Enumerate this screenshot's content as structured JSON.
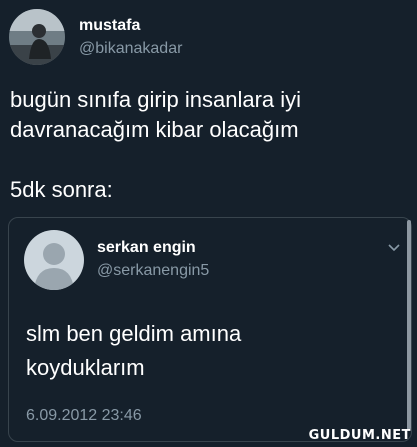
{
  "tweet": {
    "display_name": "mustafa",
    "handle": "@bikanakadar",
    "text": "bugün sınıfa girip insanlara iyi\ndavranacağım kibar olacağım\n\n5dk sonra:",
    "avatar_icon": "user-photo"
  },
  "quoted_tweet": {
    "display_name": "serkan engin",
    "handle": "@serkanengin5",
    "text": "slm ben geldim amına\nkoyduklarım",
    "timestamp": "6.09.2012 23:46",
    "avatar_icon": "default-avatar-icon",
    "menu_icon": "chevron-down-icon"
  },
  "watermark": "GULDUM.NET",
  "colors": {
    "background": "#15202b",
    "secondary_text": "#8899a6",
    "border": "#38444d"
  }
}
